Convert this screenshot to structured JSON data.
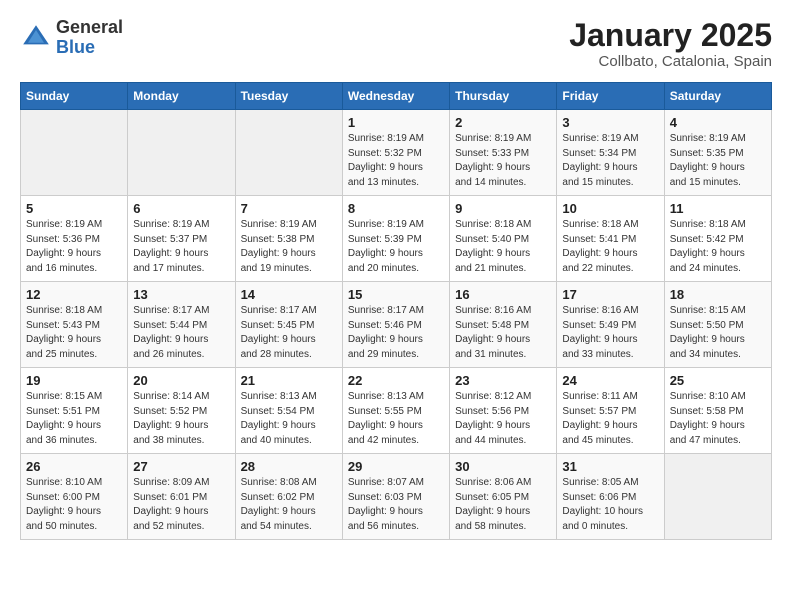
{
  "header": {
    "logo_general": "General",
    "logo_blue": "Blue",
    "title": "January 2025",
    "subtitle": "Collbato, Catalonia, Spain"
  },
  "days_of_week": [
    "Sunday",
    "Monday",
    "Tuesday",
    "Wednesday",
    "Thursday",
    "Friday",
    "Saturday"
  ],
  "weeks": [
    [
      {
        "day": "",
        "info": ""
      },
      {
        "day": "",
        "info": ""
      },
      {
        "day": "",
        "info": ""
      },
      {
        "day": "1",
        "info": "Sunrise: 8:19 AM\nSunset: 5:32 PM\nDaylight: 9 hours\nand 13 minutes."
      },
      {
        "day": "2",
        "info": "Sunrise: 8:19 AM\nSunset: 5:33 PM\nDaylight: 9 hours\nand 14 minutes."
      },
      {
        "day": "3",
        "info": "Sunrise: 8:19 AM\nSunset: 5:34 PM\nDaylight: 9 hours\nand 15 minutes."
      },
      {
        "day": "4",
        "info": "Sunrise: 8:19 AM\nSunset: 5:35 PM\nDaylight: 9 hours\nand 15 minutes."
      }
    ],
    [
      {
        "day": "5",
        "info": "Sunrise: 8:19 AM\nSunset: 5:36 PM\nDaylight: 9 hours\nand 16 minutes."
      },
      {
        "day": "6",
        "info": "Sunrise: 8:19 AM\nSunset: 5:37 PM\nDaylight: 9 hours\nand 17 minutes."
      },
      {
        "day": "7",
        "info": "Sunrise: 8:19 AM\nSunset: 5:38 PM\nDaylight: 9 hours\nand 19 minutes."
      },
      {
        "day": "8",
        "info": "Sunrise: 8:19 AM\nSunset: 5:39 PM\nDaylight: 9 hours\nand 20 minutes."
      },
      {
        "day": "9",
        "info": "Sunrise: 8:18 AM\nSunset: 5:40 PM\nDaylight: 9 hours\nand 21 minutes."
      },
      {
        "day": "10",
        "info": "Sunrise: 8:18 AM\nSunset: 5:41 PM\nDaylight: 9 hours\nand 22 minutes."
      },
      {
        "day": "11",
        "info": "Sunrise: 8:18 AM\nSunset: 5:42 PM\nDaylight: 9 hours\nand 24 minutes."
      }
    ],
    [
      {
        "day": "12",
        "info": "Sunrise: 8:18 AM\nSunset: 5:43 PM\nDaylight: 9 hours\nand 25 minutes."
      },
      {
        "day": "13",
        "info": "Sunrise: 8:17 AM\nSunset: 5:44 PM\nDaylight: 9 hours\nand 26 minutes."
      },
      {
        "day": "14",
        "info": "Sunrise: 8:17 AM\nSunset: 5:45 PM\nDaylight: 9 hours\nand 28 minutes."
      },
      {
        "day": "15",
        "info": "Sunrise: 8:17 AM\nSunset: 5:46 PM\nDaylight: 9 hours\nand 29 minutes."
      },
      {
        "day": "16",
        "info": "Sunrise: 8:16 AM\nSunset: 5:48 PM\nDaylight: 9 hours\nand 31 minutes."
      },
      {
        "day": "17",
        "info": "Sunrise: 8:16 AM\nSunset: 5:49 PM\nDaylight: 9 hours\nand 33 minutes."
      },
      {
        "day": "18",
        "info": "Sunrise: 8:15 AM\nSunset: 5:50 PM\nDaylight: 9 hours\nand 34 minutes."
      }
    ],
    [
      {
        "day": "19",
        "info": "Sunrise: 8:15 AM\nSunset: 5:51 PM\nDaylight: 9 hours\nand 36 minutes."
      },
      {
        "day": "20",
        "info": "Sunrise: 8:14 AM\nSunset: 5:52 PM\nDaylight: 9 hours\nand 38 minutes."
      },
      {
        "day": "21",
        "info": "Sunrise: 8:13 AM\nSunset: 5:54 PM\nDaylight: 9 hours\nand 40 minutes."
      },
      {
        "day": "22",
        "info": "Sunrise: 8:13 AM\nSunset: 5:55 PM\nDaylight: 9 hours\nand 42 minutes."
      },
      {
        "day": "23",
        "info": "Sunrise: 8:12 AM\nSunset: 5:56 PM\nDaylight: 9 hours\nand 44 minutes."
      },
      {
        "day": "24",
        "info": "Sunrise: 8:11 AM\nSunset: 5:57 PM\nDaylight: 9 hours\nand 45 minutes."
      },
      {
        "day": "25",
        "info": "Sunrise: 8:10 AM\nSunset: 5:58 PM\nDaylight: 9 hours\nand 47 minutes."
      }
    ],
    [
      {
        "day": "26",
        "info": "Sunrise: 8:10 AM\nSunset: 6:00 PM\nDaylight: 9 hours\nand 50 minutes."
      },
      {
        "day": "27",
        "info": "Sunrise: 8:09 AM\nSunset: 6:01 PM\nDaylight: 9 hours\nand 52 minutes."
      },
      {
        "day": "28",
        "info": "Sunrise: 8:08 AM\nSunset: 6:02 PM\nDaylight: 9 hours\nand 54 minutes."
      },
      {
        "day": "29",
        "info": "Sunrise: 8:07 AM\nSunset: 6:03 PM\nDaylight: 9 hours\nand 56 minutes."
      },
      {
        "day": "30",
        "info": "Sunrise: 8:06 AM\nSunset: 6:05 PM\nDaylight: 9 hours\nand 58 minutes."
      },
      {
        "day": "31",
        "info": "Sunrise: 8:05 AM\nSunset: 6:06 PM\nDaylight: 10 hours\nand 0 minutes."
      },
      {
        "day": "",
        "info": ""
      }
    ]
  ]
}
